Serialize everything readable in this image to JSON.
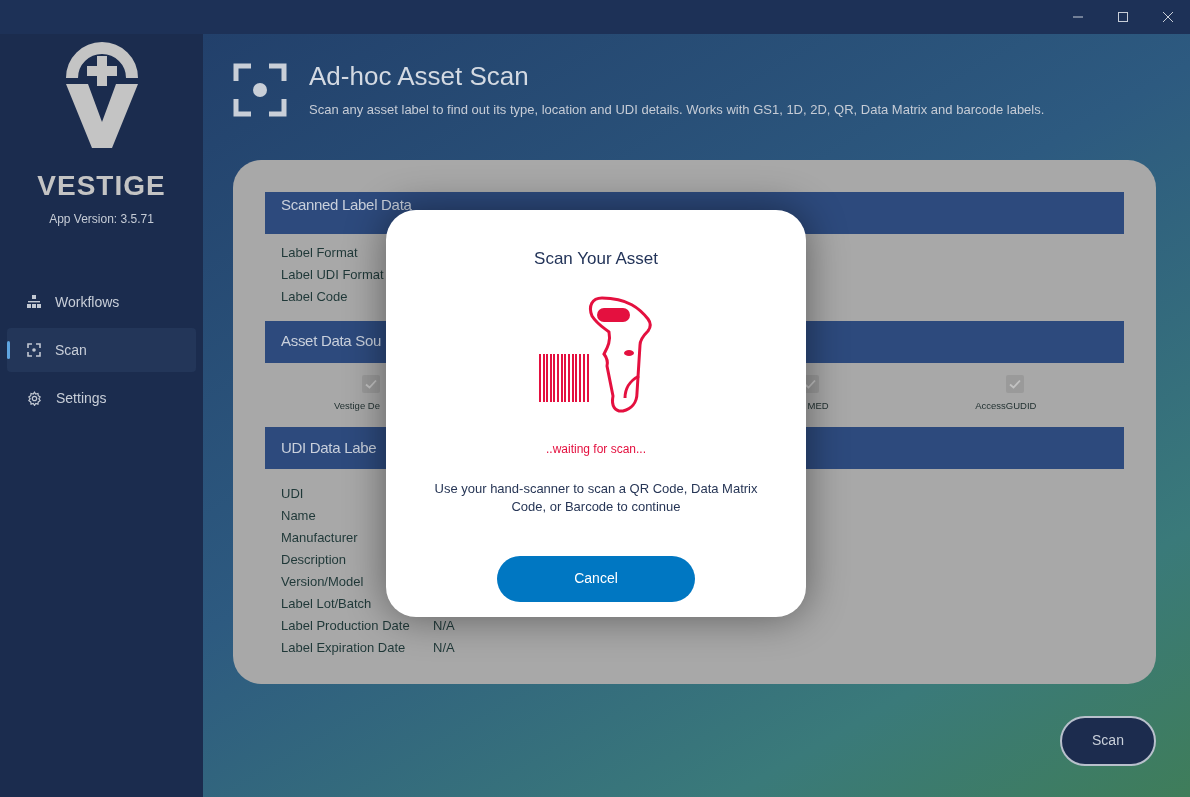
{
  "sidebar": {
    "brand": "VESTIGE",
    "version": "App Version: 3.5.71",
    "items": [
      {
        "label": "Workflows",
        "selected": false
      },
      {
        "label": "Scan",
        "selected": true
      },
      {
        "label": "Settings",
        "selected": false
      }
    ]
  },
  "header": {
    "title": "Ad-hoc Asset Scan",
    "subtitle": "Scan any asset label to find out its type, location and UDI details. Works with GS1, 1D, 2D, QR, Data Matrix and barcode labels."
  },
  "sections": [
    {
      "kind": "fields",
      "title": "Scanned Label Data",
      "rows": [
        {
          "label": "Label Format"
        },
        {
          "label": "Label UDI Format"
        },
        {
          "label": "Label Code"
        }
      ]
    },
    {
      "kind": "sources",
      "title": "Asset Data Sou",
      "sources": [
        {
          "label": "Vestige De",
          "checked": true
        },
        {
          "label": "MED",
          "checked": true
        },
        {
          "label": "AccessGUDID",
          "checked": true
        }
      ]
    },
    {
      "kind": "fields",
      "title": "UDI Data Labe",
      "rows": [
        {
          "label": "UDI"
        },
        {
          "label": "Name"
        },
        {
          "label": "Manufacturer"
        },
        {
          "label": "Description"
        },
        {
          "label": "Version/Model"
        },
        {
          "label": "Label Lot/Batch"
        },
        {
          "label": "Label Production Date",
          "value": "N/A"
        },
        {
          "label": "Label Expiration Date",
          "value": "N/A"
        }
      ]
    }
  ],
  "scan_button": "Scan",
  "dialog": {
    "title": "Scan Your Asset",
    "status": "..waiting for scan...",
    "message": "Use your hand-scanner to scan a QR Code, Data Matrix Code, or Barcode to continue",
    "cancel": "Cancel"
  }
}
